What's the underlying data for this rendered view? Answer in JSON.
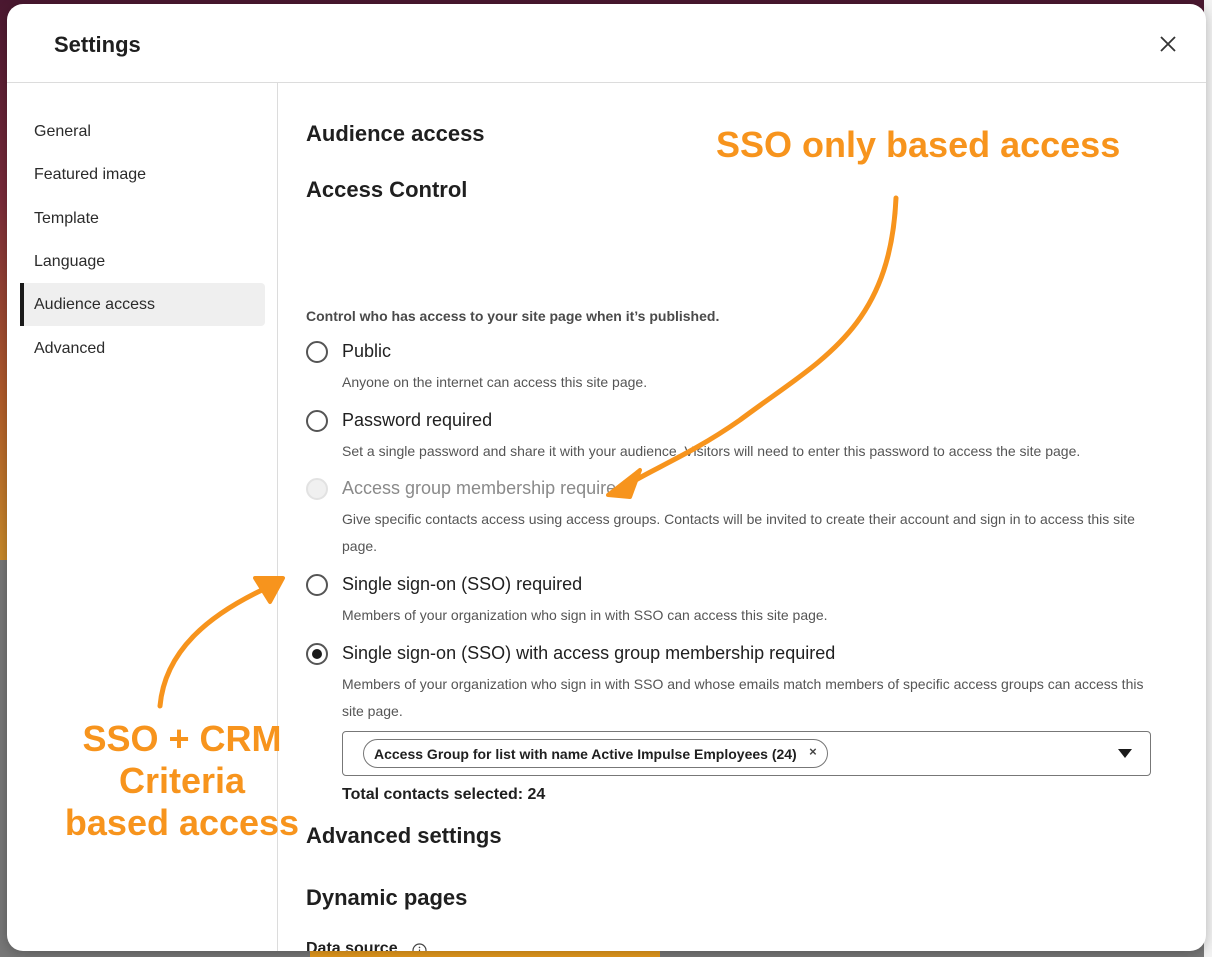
{
  "modal": {
    "title": "Settings",
    "close_icon": "close-icon"
  },
  "sidebar": {
    "items": [
      {
        "label": "General"
      },
      {
        "label": "Featured image"
      },
      {
        "label": "Template"
      },
      {
        "label": "Language"
      },
      {
        "label": "Audience access",
        "active": true
      },
      {
        "label": "Advanced"
      }
    ]
  },
  "content": {
    "section_title": "Audience access",
    "subsection_title": "Access Control",
    "help_text": "Control who has access to your site page when it’s published.",
    "options": [
      {
        "label": "Public",
        "description": "Anyone on the internet can access this site page.",
        "state": "unchecked"
      },
      {
        "label": "Password required",
        "description": "Set a single password and share it with your audience. Visitors will need to enter this password to access the site page.",
        "state": "unchecked"
      },
      {
        "label": "Access group membership required",
        "description": "Give specific contacts access using access groups. Contacts will be invited to create their account and sign in to access this site page.",
        "state": "disabled"
      },
      {
        "label": "Single sign-on (SSO) required",
        "description": "Members of your organization who sign in with SSO can access this site page.",
        "state": "unchecked"
      },
      {
        "label": "Single sign-on (SSO) with access group membership required",
        "description": "Members of your organization who sign in with SSO and whose emails match members of specific access groups can access this site page.",
        "state": "checked"
      }
    ],
    "access_group_select": {
      "selected_tag": "Access Group for list with name Active Impulse Employees (24)",
      "remove_label": "×"
    },
    "total_contacts": "Total contacts selected: 24",
    "advanced_title": "Advanced settings",
    "dynamic_title": "Dynamic pages",
    "data_source_label": "Data source"
  },
  "annotations": {
    "top": "SSO only based access",
    "bottom_line1": "SSO + CRM Criteria",
    "bottom_line2": "based access",
    "color": "#f7941d"
  }
}
